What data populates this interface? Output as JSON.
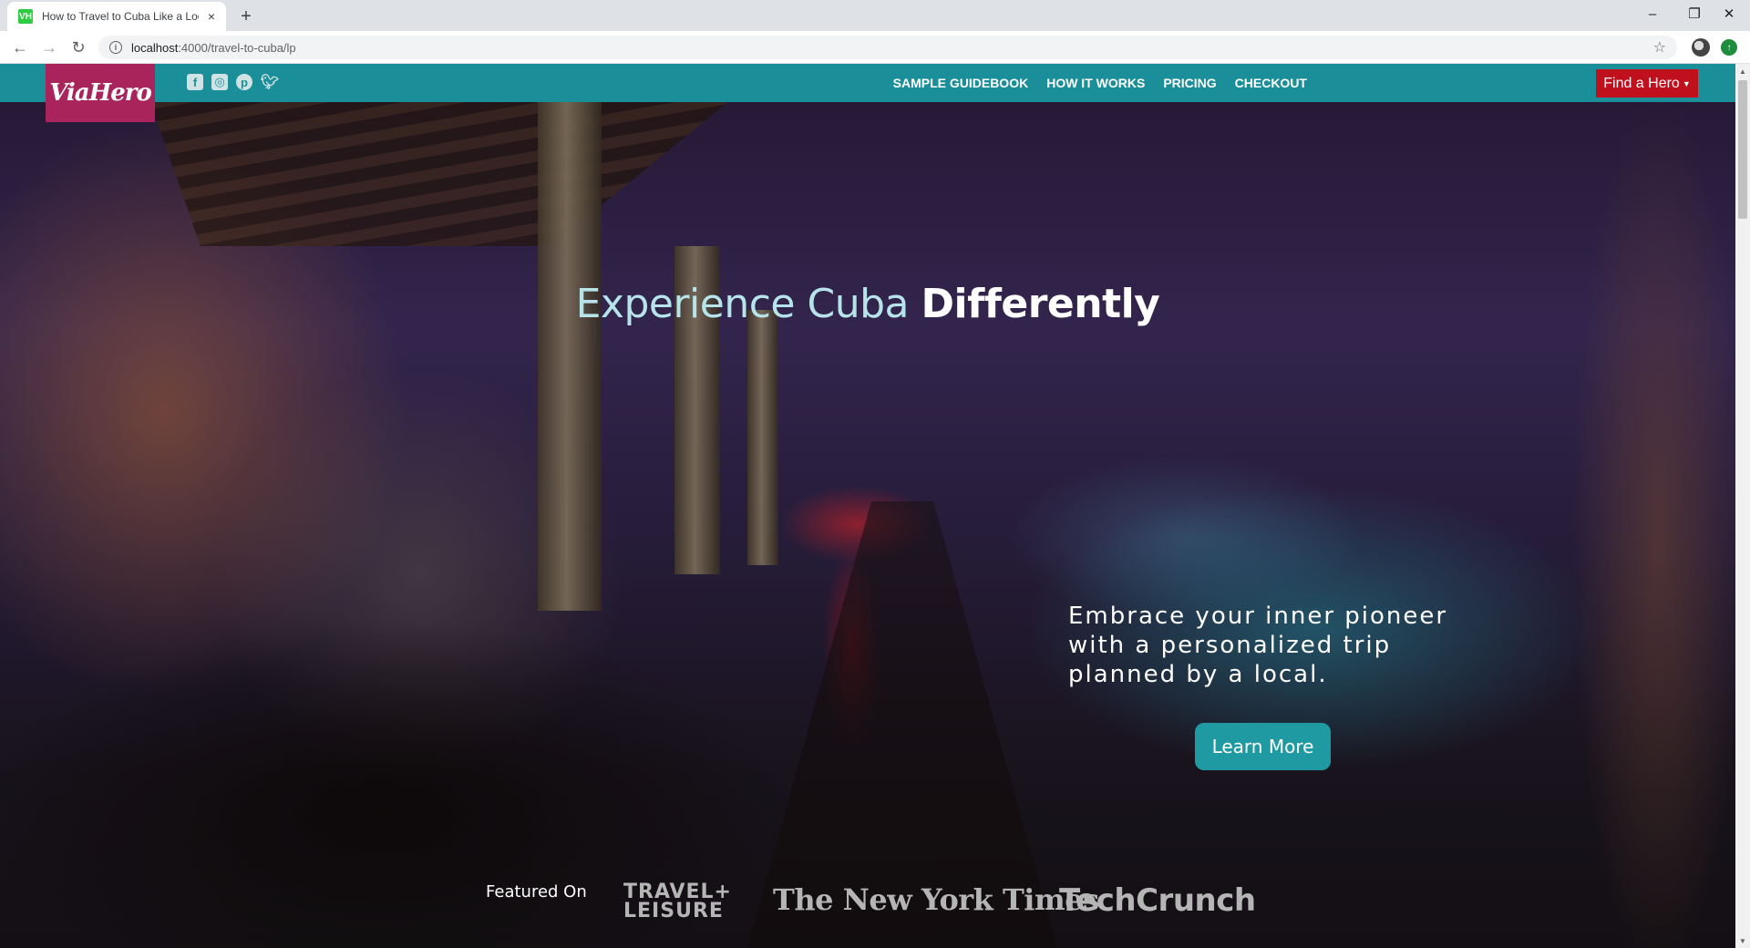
{
  "browser": {
    "tab_title": "How to Travel to Cuba Like a Loc",
    "favicon_text": "VH",
    "url_host": "localhost",
    "url_path": ":4000/travel-to-cuba/lp",
    "new_tab_symbol": "+",
    "close_symbol": "×"
  },
  "nav": {
    "logo_text": "ViaHero",
    "social": [
      "facebook-icon",
      "instagram-icon",
      "pinterest-icon",
      "twitter-icon"
    ],
    "links": [
      "SAMPLE GUIDEBOOK",
      "HOW IT WORKS",
      "PRICING",
      "CHECKOUT"
    ],
    "find_hero": "Find a Hero"
  },
  "hero": {
    "headline_light": "Experience Cuba ",
    "headline_bold": "Differently",
    "tagline": "Embrace your inner pioneer with a personalized trip planned by a local.",
    "cta": "Learn More"
  },
  "featured": {
    "label": "Featured On",
    "press": [
      "TRAVEL+",
      "LEISURE",
      "The New York Times",
      "TechCrunch"
    ]
  },
  "colors": {
    "nav_bg": "#1b8f99",
    "logo_bg": "#a8245a",
    "find_hero_bg": "#c0101e",
    "cta_bg": "#1f9aa3"
  }
}
